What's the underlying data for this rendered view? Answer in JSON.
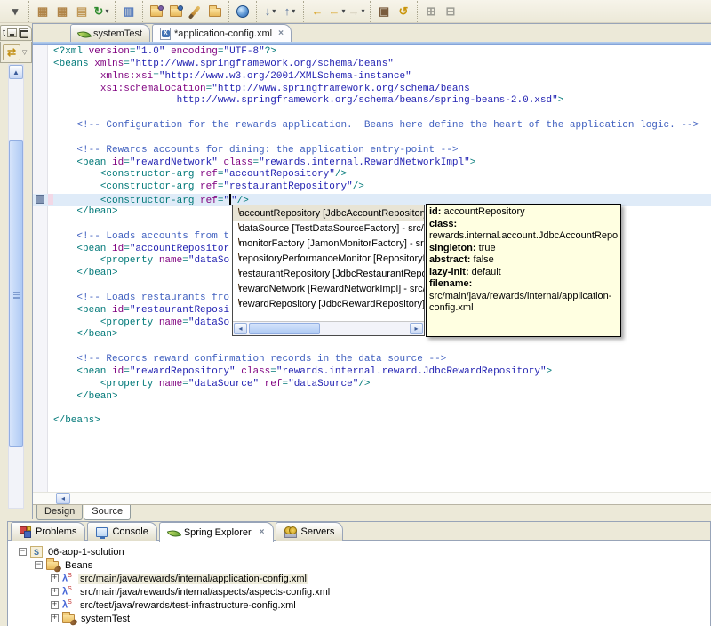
{
  "colors": {
    "ui_background": "#ECE9D8",
    "accent_blue_band": "#7C9ED6",
    "current_line_highlight": "#DFEBF8",
    "tooltip_background": "#FFFFE1",
    "syntax_tag": "#007878",
    "syntax_attribute": "#7F007F",
    "syntax_value": "#2222B2",
    "syntax_comment": "#3F5FBF"
  },
  "toolbar": {
    "groups": [
      [
        {
          "name": "overflow-dropdown-icon",
          "glyph": "▾",
          "color": "#555555"
        }
      ],
      [
        {
          "name": "open-type-icon",
          "glyph": "▦",
          "color": "#B08448"
        },
        {
          "name": "open-type-hierarchy-icon",
          "glyph": "▦",
          "color": "#B08448"
        },
        {
          "name": "new-package-icon",
          "glyph": "▤",
          "color": "#C09858"
        },
        {
          "name": "refresh-icon",
          "glyph": "↻",
          "color": "#2E8B2E",
          "dropdown": true
        }
      ],
      [
        {
          "name": "properties-form-icon",
          "glyph": "▥",
          "color": "#5B7FBE"
        }
      ],
      [
        {
          "name": "import-folder-icon",
          "css": "folder",
          "orb": "#7B5EA7"
        },
        {
          "name": "export-folder-icon",
          "css": "folder",
          "orb": "#3E6FB5"
        },
        {
          "name": "paintbrush-icon",
          "css": "brush"
        },
        {
          "name": "open-folder-icon",
          "css": "folder"
        }
      ],
      [
        {
          "name": "web-browser-icon",
          "css": "globe"
        }
      ],
      [
        {
          "name": "next-annotation-button",
          "glyph": "↓",
          "color": "#55709B",
          "dropdown": true
        },
        {
          "name": "previous-annotation-button",
          "glyph": "↑",
          "color": "#55709B",
          "dropdown": true
        }
      ],
      [
        {
          "name": "last-edit-location-button",
          "glyph": "←",
          "color": "#D8A01D"
        },
        {
          "name": "back-button",
          "glyph": "←",
          "color": "#D8A01D",
          "dropdown": true
        },
        {
          "name": "forward-button",
          "glyph": "→",
          "color": "#C9C3AE",
          "dropdown": true
        }
      ],
      [
        {
          "name": "pin-editor-icon",
          "glyph": "▣",
          "color": "#7A5C3E"
        },
        {
          "name": "snippet-refresh-icon",
          "glyph": "↺",
          "color": "#C9940A"
        }
      ],
      [
        {
          "name": "expand-all-button",
          "glyph": "⊞",
          "color": "#9C9C94"
        },
        {
          "name": "collapse-all-button",
          "glyph": "⊟",
          "color": "#9C9C94"
        }
      ]
    ]
  },
  "left_strip": {
    "tab_label": "t",
    "sync_icon_glyph": "⇄",
    "chevron_glyph": "▽"
  },
  "editor": {
    "tabs": [
      {
        "label": "systemTest",
        "icon": "spring-leaf-icon",
        "active": false,
        "closable": false
      },
      {
        "label": "*application-config.xml",
        "icon": "xml-file-icon",
        "active": true,
        "closable": true
      }
    ],
    "page_tabs": [
      {
        "label": "Design",
        "active": false
      },
      {
        "label": "Source",
        "active": true
      }
    ],
    "current_line": 13,
    "close_glyph": "×",
    "lines": [
      [
        [
          "t",
          "<?xml "
        ],
        [
          "a",
          "version"
        ],
        [
          "t",
          "="
        ],
        [
          "v",
          "\"1.0\""
        ],
        [
          "p",
          " "
        ],
        [
          "a",
          "encoding"
        ],
        [
          "t",
          "="
        ],
        [
          "v",
          "\"UTF-8\""
        ],
        [
          "t",
          "?>"
        ]
      ],
      [
        [
          "t",
          "<beans "
        ],
        [
          "a",
          "xmlns"
        ],
        [
          "t",
          "="
        ],
        [
          "v",
          "\"http://www.springframework.org/schema/beans\""
        ]
      ],
      [
        [
          "p",
          "        "
        ],
        [
          "a",
          "xmlns:xsi"
        ],
        [
          "t",
          "="
        ],
        [
          "v",
          "\"http://www.w3.org/2001/XMLSchema-instance\""
        ]
      ],
      [
        [
          "p",
          "        "
        ],
        [
          "a",
          "xsi:schemaLocation"
        ],
        [
          "t",
          "="
        ],
        [
          "v",
          "\"http://www.springframework.org/schema/beans"
        ]
      ],
      [
        [
          "p",
          "                     "
        ],
        [
          "v",
          "http://www.springframework.org/schema/beans/spring-beans-2.0.xsd\""
        ],
        [
          "t",
          ">"
        ]
      ],
      [],
      [
        [
          "p",
          "    "
        ],
        [
          "c",
          "<!-- Configuration for the rewards application.  Beans here define the heart of the application logic. -->"
        ]
      ],
      [],
      [
        [
          "p",
          "    "
        ],
        [
          "c",
          "<!-- Rewards accounts for dining: the application entry-point -->"
        ]
      ],
      [
        [
          "p",
          "    "
        ],
        [
          "t",
          "<bean "
        ],
        [
          "a",
          "id"
        ],
        [
          "t",
          "="
        ],
        [
          "v",
          "\"rewardNetwork\""
        ],
        [
          "p",
          " "
        ],
        [
          "a",
          "class"
        ],
        [
          "t",
          "="
        ],
        [
          "v",
          "\"rewards.internal.RewardNetworkImpl\""
        ],
        [
          "t",
          ">"
        ]
      ],
      [
        [
          "p",
          "        "
        ],
        [
          "t",
          "<constructor-arg "
        ],
        [
          "a",
          "ref"
        ],
        [
          "t",
          "="
        ],
        [
          "v",
          "\"accountRepository\""
        ],
        [
          "t",
          "/>"
        ]
      ],
      [
        [
          "p",
          "        "
        ],
        [
          "t",
          "<constructor-arg "
        ],
        [
          "a",
          "ref"
        ],
        [
          "t",
          "="
        ],
        [
          "v",
          "\"restaurantRepository\""
        ],
        [
          "t",
          "/>"
        ]
      ],
      [
        [
          "p",
          "        "
        ],
        [
          "t",
          "<constructor-arg "
        ],
        [
          "a",
          "ref"
        ],
        [
          "t",
          "="
        ],
        [
          "v",
          "\""
        ],
        [
          "caret",
          ""
        ],
        [
          "v",
          "\""
        ],
        [
          "t",
          "/>"
        ]
      ],
      [
        [
          "p",
          "    "
        ],
        [
          "t",
          "</bean>"
        ]
      ],
      [],
      [
        [
          "p",
          "    "
        ],
        [
          "c",
          "<!-- Loads accounts from t"
        ]
      ],
      [
        [
          "p",
          "    "
        ],
        [
          "t",
          "<bean "
        ],
        [
          "a",
          "id"
        ],
        [
          "t",
          "="
        ],
        [
          "v",
          "\"accountRepositor"
        ]
      ],
      [
        [
          "p",
          "        "
        ],
        [
          "t",
          "<property "
        ],
        [
          "a",
          "name"
        ],
        [
          "t",
          "="
        ],
        [
          "v",
          "\"dataSo"
        ]
      ],
      [
        [
          "p",
          "    "
        ],
        [
          "t",
          "</bean>"
        ]
      ],
      [],
      [
        [
          "p",
          "    "
        ],
        [
          "c",
          "<!-- Loads restaurants fro"
        ]
      ],
      [
        [
          "p",
          "    "
        ],
        [
          "t",
          "<bean "
        ],
        [
          "a",
          "id"
        ],
        [
          "t",
          "="
        ],
        [
          "v",
          "\"restaurantReposi"
        ]
      ],
      [
        [
          "p",
          "        "
        ],
        [
          "t",
          "<property "
        ],
        [
          "a",
          "name"
        ],
        [
          "t",
          "="
        ],
        [
          "v",
          "\"dataSo"
        ]
      ],
      [
        [
          "p",
          "    "
        ],
        [
          "t",
          "</bean>"
        ]
      ],
      [],
      [
        [
          "p",
          "    "
        ],
        [
          "c",
          "<!-- Records reward confirmation records in the data source -->"
        ]
      ],
      [
        [
          "p",
          "    "
        ],
        [
          "t",
          "<bean "
        ],
        [
          "a",
          "id"
        ],
        [
          "t",
          "="
        ],
        [
          "v",
          "\"rewardRepository\""
        ],
        [
          "p",
          " "
        ],
        [
          "a",
          "class"
        ],
        [
          "t",
          "="
        ],
        [
          "v",
          "\"rewards.internal.reward.JdbcRewardRepository\""
        ],
        [
          "t",
          ">"
        ]
      ],
      [
        [
          "p",
          "        "
        ],
        [
          "t",
          "<property "
        ],
        [
          "a",
          "name"
        ],
        [
          "t",
          "="
        ],
        [
          "v",
          "\"dataSource\""
        ],
        [
          "p",
          " "
        ],
        [
          "a",
          "ref"
        ],
        [
          "t",
          "="
        ],
        [
          "v",
          "\"dataSource\""
        ],
        [
          "t",
          "/>"
        ]
      ],
      [
        [
          "p",
          "    "
        ],
        [
          "t",
          "</bean>"
        ]
      ],
      [],
      [
        [
          "t",
          "</beans>"
        ]
      ]
    ]
  },
  "assist_popup": {
    "items": [
      {
        "label": "accountRepository [JdbcAccountRepository] - src",
        "selected": true
      },
      {
        "label": "dataSource [TestDataSourceFactory] - src/test/ja",
        "selected": false
      },
      {
        "label": "monitorFactory [JamonMonitorFactory] - src/main",
        "selected": false
      },
      {
        "label": "repositoryPerformanceMonitor [RepositoryPerform",
        "selected": false
      },
      {
        "label": "restaurantRepository [JdbcRestaurantRepository",
        "selected": false
      },
      {
        "label": "rewardNetwork [RewardNetworkImpl] - src/main/j",
        "selected": false
      },
      {
        "label": "rewardRepository [JdbcRewardRepository] - src/r",
        "selected": false
      }
    ]
  },
  "bean_tooltip": {
    "fields": [
      {
        "label": "id:",
        "value": "accountRepository",
        "own_line": false,
        "nowrap": true
      },
      {
        "label": "class:",
        "value": "rewards.internal.account.JdbcAccountRepository",
        "own_line": true,
        "nowrap": true
      },
      {
        "label": "singleton:",
        "value": "true",
        "own_line": false,
        "nowrap": true
      },
      {
        "label": "abstract:",
        "value": "false",
        "own_line": false,
        "nowrap": true
      },
      {
        "label": "lazy-init:",
        "value": "default",
        "own_line": false,
        "nowrap": true
      },
      {
        "label": "filename:",
        "value": "src/main/java/rewards/internal/application-config.xml",
        "own_line": false,
        "nowrap": false
      }
    ]
  },
  "bottom_panel": {
    "tabs": [
      {
        "label": "Problems",
        "icon": "problems-icon",
        "active": false,
        "closable": false
      },
      {
        "label": "Console",
        "icon": "console-icon",
        "active": false,
        "closable": false
      },
      {
        "label": "Spring Explorer",
        "icon": "spring-leaf-icon",
        "active": true,
        "closable": true
      },
      {
        "label": "Servers",
        "icon": "servers-icon",
        "active": false,
        "closable": false
      }
    ],
    "tree": [
      {
        "label": "06-aop-1-solution",
        "level": 0,
        "expander": "-",
        "icon": "spring-project-icon",
        "selected": false
      },
      {
        "label": "Beans",
        "level": 1,
        "expander": "-",
        "icon": "beans-folder-icon",
        "selected": false
      },
      {
        "label": "src/main/java/rewards/internal/application-config.xml",
        "level": 2,
        "expander": "+",
        "icon": "spring-config-file-icon",
        "selected": true
      },
      {
        "label": "src/main/java/rewards/internal/aspects/aspects-config.xml",
        "level": 2,
        "expander": "+",
        "icon": "spring-config-file-icon",
        "selected": false
      },
      {
        "label": "src/test/java/rewards/test-infrastructure-config.xml",
        "level": 2,
        "expander": "+",
        "icon": "spring-config-file-icon",
        "selected": false
      },
      {
        "label": "systemTest",
        "level": 2,
        "expander": "+",
        "icon": "config-set-icon",
        "selected": false
      }
    ]
  }
}
